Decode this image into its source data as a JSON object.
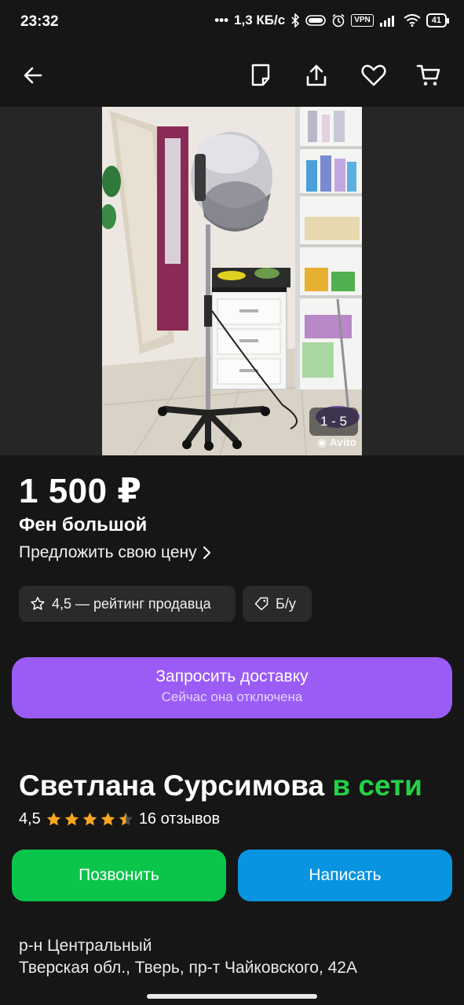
{
  "status_bar": {
    "time": "23:32",
    "network_speed": "1,3 КБ/с",
    "vpn": "VPN",
    "battery": "41",
    "icons": [
      "dots-icon",
      "bluetooth-icon",
      "toggle-icon",
      "alarm-icon",
      "vpn-icon",
      "signal-icon",
      "wifi-icon",
      "battery-icon"
    ]
  },
  "top_bar": {
    "icons": [
      "back-arrow-icon",
      "note-icon",
      "share-icon",
      "heart-icon",
      "cart-icon"
    ]
  },
  "gallery": {
    "counter": "1 - 5",
    "watermark": "Avito"
  },
  "listing": {
    "price": "1 500 ₽",
    "title": "Фен большой",
    "offer_price": "Предложить свою цену"
  },
  "chips": {
    "rating": "4,5 — рейтинг продавца",
    "condition": "Б/у"
  },
  "delivery": {
    "label": "Запросить доставку",
    "sublabel": "Сейчас она отключена"
  },
  "seller": {
    "name": "Светлана Сурсимова",
    "status": "в сети",
    "rating": "4,5",
    "stars": 4.5,
    "reviews": "16 отзывов"
  },
  "actions": {
    "call": "Позвонить",
    "message": "Написать"
  },
  "location": {
    "district": "р-н Центральный",
    "address": "Тверская обл., Тверь, пр-т Чайковского, 42А"
  },
  "colors": {
    "background": "#161616",
    "delivery_button": "#9b5cf6",
    "call_button": "#0ac54a",
    "message_button": "#0894e0",
    "online_text": "#25d146",
    "star": "#f5a623"
  }
}
